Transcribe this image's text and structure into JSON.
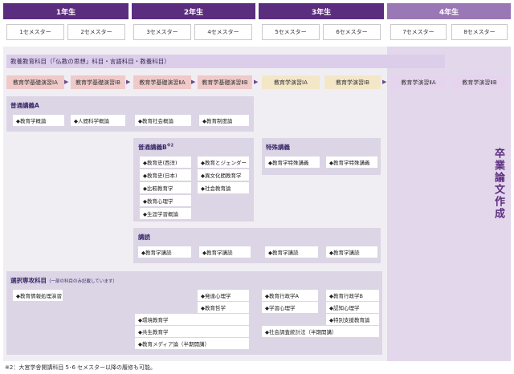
{
  "years": [
    "1年生",
    "2年生",
    "3年生",
    "4年生"
  ],
  "semesters": [
    "1セメスター",
    "2セメスター",
    "3セメスター",
    "4セメスター",
    "5セメスター",
    "6セメスター",
    "7セメスター",
    "8セメスター"
  ],
  "liberal_band": "教養教育科目（「仏教の思想」科目・言語科目・教養科目）",
  "seminars": [
    "教育学基礎演習ⅠA",
    "教育学基礎演習ⅠB",
    "教育学基礎演習ⅡA",
    "教育学基礎演習ⅡB",
    "教育学演習ⅠA",
    "教育学演習ⅠB",
    "教育学演習ⅡA",
    "教育学演習ⅡB"
  ],
  "arrow_glyph": "▶",
  "general_a": {
    "title": "普通講義A",
    "items": [
      "◆教育学概論",
      "◆人間科学概論",
      "◆教育社会概論",
      "◆教育制度論"
    ]
  },
  "general_b": {
    "title": "普通講義B",
    "title_sup": "※2",
    "items_left": [
      "◆教育史(西洋)",
      "◆教育史(日本)",
      "◆比較教育学",
      "◆教育心理学",
      "◆生涯学習概論"
    ],
    "items_right": [
      "◆教育とジェンダー",
      "◆異文化間教育学",
      "◆社会教育論"
    ]
  },
  "special": {
    "title": "特殊講義",
    "items": [
      "◆教育学特殊講義",
      "◆教育学特殊講義"
    ]
  },
  "lecture": {
    "title": "講読",
    "items": [
      "◆教育学講読",
      "◆教育学講読",
      "◆教育学講読",
      "◆教育学講読"
    ]
  },
  "elective": {
    "title": "選択専攻科目",
    "note": "（一部の科目のみ記載しています）",
    "items": {
      "info": "◆教育情報処理演習",
      "dev_psy": "◆発達心理学",
      "edu_phil": "◆教育哲学",
      "env": "◆環境教育学",
      "coexist": "◆共生教育学",
      "media": "◆教育メディア論（半期開講）",
      "admin_a": "◆教育行政学A",
      "admin_b": "◆教育行政学B",
      "learn_psy": "◆学習心理学",
      "cog_psy": "◆認知心理学",
      "special_support": "◆特別支援教育論",
      "survey": "◆社会調査統計法（半期開講）"
    }
  },
  "thesis": "卒業論文作成",
  "footnote": "※2：大宮学舎開講科目 5･6 セメスター以降の履修も可能。"
}
